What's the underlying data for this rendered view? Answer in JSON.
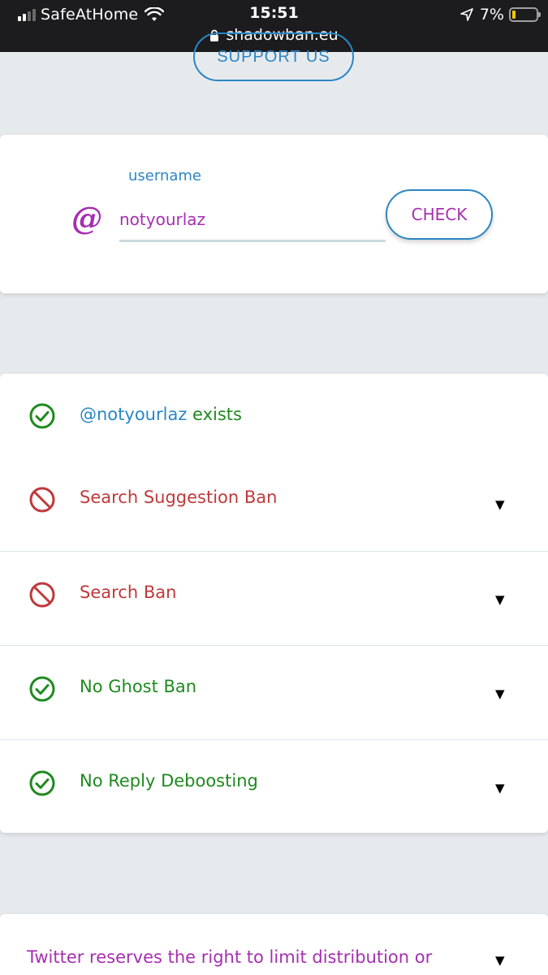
{
  "status_bar": {
    "carrier": "SafeAtHome",
    "time": "15:51",
    "url": "shadowban.eu",
    "battery_percent": "7%"
  },
  "support_button": {
    "label": "SUPPORT US"
  },
  "search": {
    "field_label": "username",
    "at_symbol": "@",
    "username_value": "notyourlaz",
    "check_label": "CHECK"
  },
  "results": [
    {
      "handle": "@notyourlaz",
      "label": " exists",
      "status": "ok",
      "icon": "check-circle-icon"
    },
    {
      "label": "Search Suggestion Ban",
      "status": "banned",
      "icon": "prohibited-icon",
      "expand": "▼"
    },
    {
      "label": "Search Ban",
      "status": "banned",
      "icon": "prohibited-icon",
      "expand": "▼"
    },
    {
      "label": "No Ghost Ban",
      "status": "ok",
      "icon": "check-circle-icon",
      "expand": "▼"
    },
    {
      "label": "No Reply Deboosting",
      "status": "ok",
      "icon": "check-circle-icon",
      "expand": "▼"
    }
  ],
  "notice": {
    "text": "Twitter reserves the right to limit distribution or visibility of",
    "expand": "▼"
  },
  "colors": {
    "accent_blue": "#2b86c5",
    "accent_purple": "#a62fb0",
    "ok_green": "#1f8a1f",
    "ban_red": "#c0393b"
  }
}
